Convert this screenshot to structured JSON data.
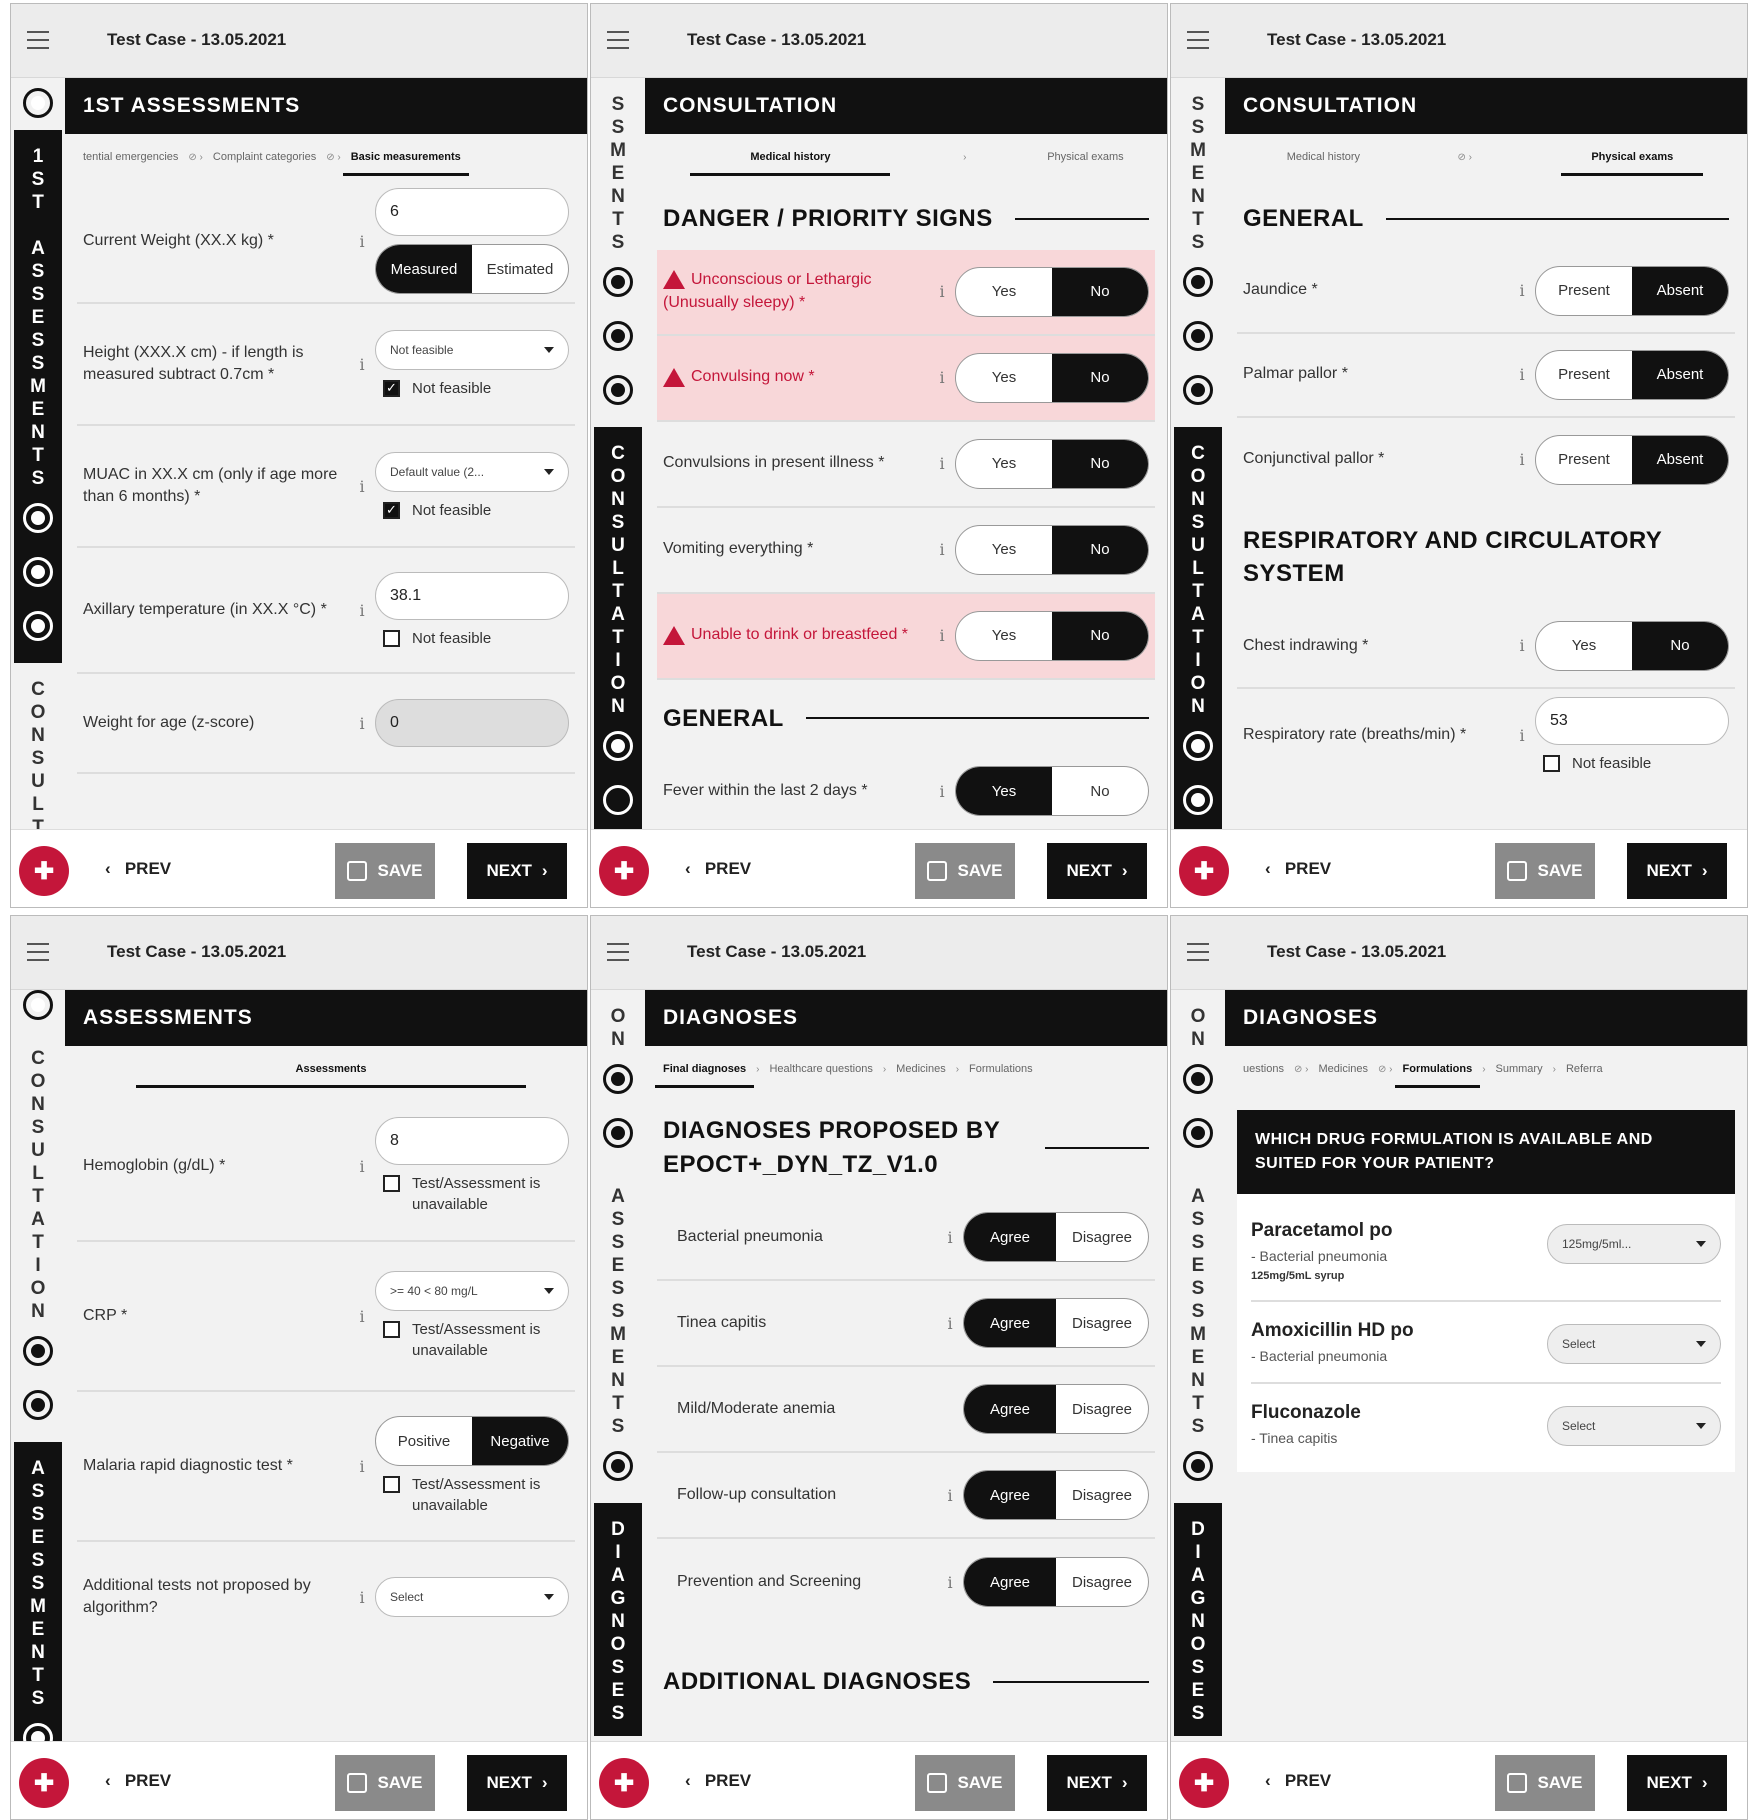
{
  "case_title": "Test Case - 13.05.2021",
  "nav": {
    "prev": "PREV",
    "save": "SAVE",
    "next": "NEXT"
  },
  "p1": {
    "header": "1ST ASSESSMENTS",
    "side": [
      "1ST ASSESSMENTS",
      "CONSULT"
    ],
    "tabs": [
      "tential emergencies",
      "Complaint categories",
      "Basic measurements"
    ],
    "rows": [
      {
        "label": "Current Weight (XX.X kg) *",
        "input": "6",
        "seg": [
          "Measured",
          "Estimated"
        ]
      },
      {
        "label": "Height (XXX.X cm) - if length is measured subtract 0.7cm *",
        "select": "Not feasible",
        "check": "Not feasible"
      },
      {
        "label": "MUAC in XX.X cm (only if age more than 6 months) *",
        "select": "Default value (2...",
        "check": "Not feasible"
      },
      {
        "label": "Axillary temperature (in XX.X °C) *",
        "input": "38.1",
        "check": "Not feasible"
      },
      {
        "label": "Weight for age (z-score)",
        "input": "0"
      }
    ]
  },
  "p2": {
    "header": "CONSULTATION",
    "side": [
      "SSMENTS",
      "CONSULTATION"
    ],
    "tabs": [
      "Medical history",
      "Physical exams"
    ],
    "sec1": "DANGER / PRIORITY SIGNS",
    "sec2": "GENERAL",
    "yes": "Yes",
    "no": "No",
    "rows": [
      "Unconscious or Lethargic (Unusually sleepy) *",
      "Convulsing now *",
      "Convulsions in present illness *",
      "Vomiting everything *",
      "Unable to drink or breastfeed *",
      "Fever within the last 2 days *"
    ]
  },
  "p3": {
    "header": "CONSULTATION",
    "side": [
      "SSMENTS",
      "CONSULTATION"
    ],
    "tabs": [
      "Medical history",
      "Physical exams"
    ],
    "sec1": "GENERAL",
    "sec2": "RESPIRATORY AND CIRCULATORY SYSTEM",
    "present": "Present",
    "absent": "Absent",
    "yes": "Yes",
    "no": "No",
    "rows": [
      "Jaundice *",
      "Palmar pallor *",
      "Conjunctival pallor *"
    ],
    "chest": "Chest indrawing *",
    "resp": "Respiratory rate (breaths/min) *",
    "resp_val": "53",
    "check": "Not feasible"
  },
  "p4": {
    "header": "ASSESSMENTS",
    "side": [
      "CONSULTATION",
      "ASSESSMENTS"
    ],
    "tab": "Assessments",
    "rows": [
      {
        "label": "Hemoglobin (g/dL) *",
        "input": "8",
        "check": "Test/Assessment is unavailable"
      },
      {
        "label": "CRP *",
        "select": ">= 40 < 80 mg/L",
        "check": "Test/Assessment is unavailable"
      },
      {
        "label": "Malaria rapid diagnostic test *",
        "seg": [
          "Positive",
          "Negative"
        ],
        "check": "Test/Assessment is unavailable"
      },
      {
        "label": "Additional tests not proposed by algorithm?",
        "select": "Select"
      }
    ]
  },
  "p5": {
    "header": "DIAGNOSES",
    "side": [
      "ON",
      "ASSESSMENTS",
      "DIAGNOSES"
    ],
    "tabs": [
      "Final diagnoses",
      "Healthcare questions",
      "Medicines",
      "Formulations"
    ],
    "sec1": "DIAGNOSES PROPOSED BY EPOCT+_DYN_TZ_V1.0",
    "sec2": "ADDITIONAL DIAGNOSES",
    "agree": "Agree",
    "disagree": "Disagree",
    "rows": [
      "Bacterial pneumonia",
      "Tinea capitis",
      "Mild/Moderate anemia",
      "Follow-up consultation",
      "Prevention and Screening"
    ]
  },
  "p6": {
    "header": "DIAGNOSES",
    "side": [
      "ON",
      "ASSESSMENTS",
      "DIAGNOSES"
    ],
    "tabs": [
      "uestions",
      "Medicines",
      "Formulations",
      "Summary",
      "Referra"
    ],
    "question": "WHICH DRUG FORMULATION IS AVAILABLE AND SUITED FOR YOUR PATIENT?",
    "meds": [
      {
        "name": "Paracetamol po",
        "sub": "- Bacterial pneumonia",
        "note": "125mg/5mL syrup",
        "select": "125mg/5ml..."
      },
      {
        "name": "Amoxicillin HD po",
        "sub": "- Bacterial pneumonia",
        "select": "Select"
      },
      {
        "name": "Fluconazole",
        "sub": "- Tinea capitis",
        "select": "Select"
      }
    ]
  },
  "colors": {
    "brand": "#c4163a",
    "dark": "#111111",
    "alert_bg": "#f8d7d9"
  }
}
